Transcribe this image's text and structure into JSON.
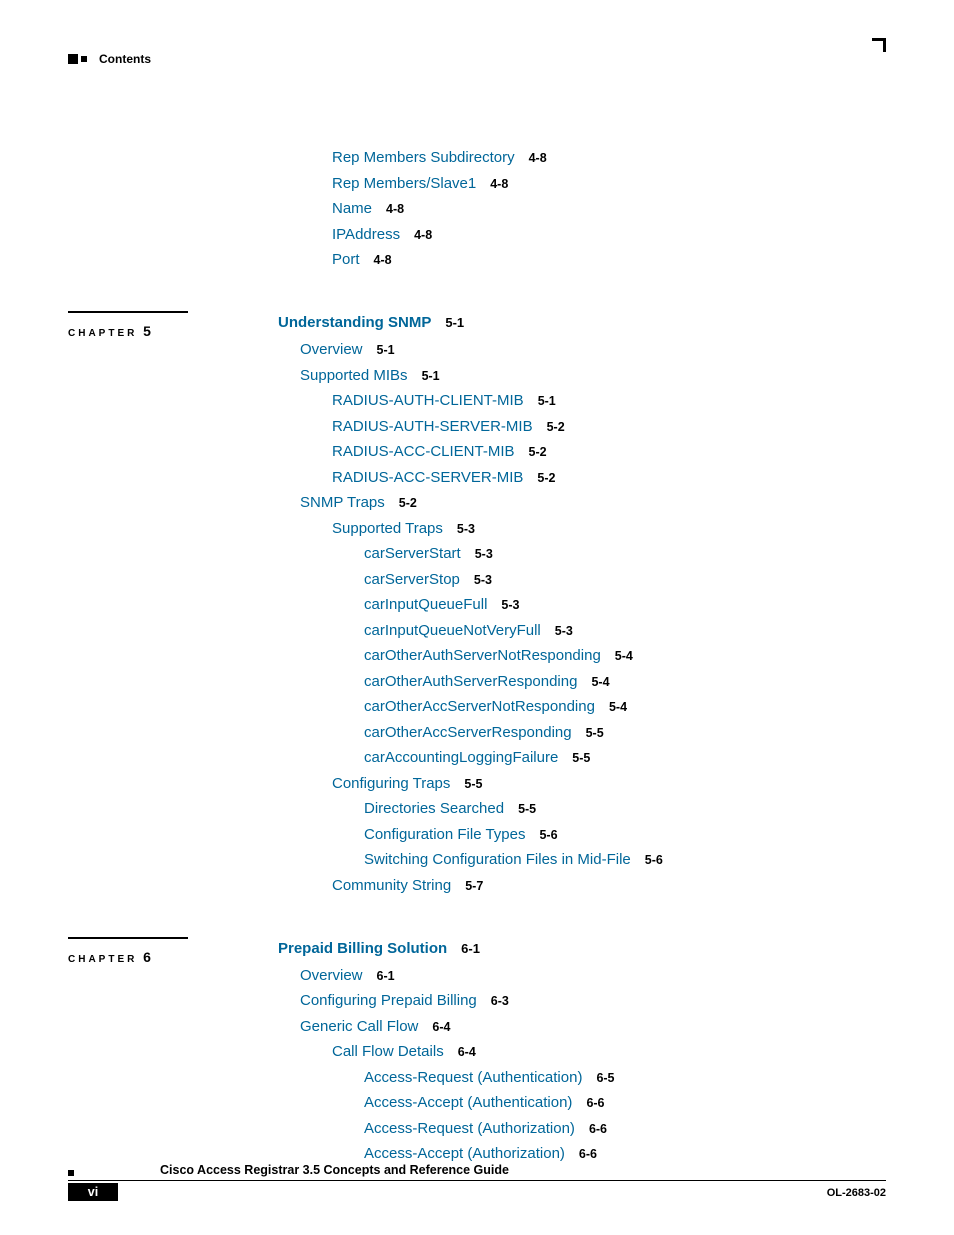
{
  "header": {
    "running_head": "Contents"
  },
  "footer": {
    "doc_title": "Cisco Access Registrar 3.5 Concepts and Reference Guide",
    "page_roman": "vi",
    "part_no": "OL-2683-02"
  },
  "groups": [
    {
      "chapter_label": "",
      "chapter_num": "",
      "items": [
        {
          "level": 2,
          "text": "Rep Members Subdirectory",
          "page": "4-8"
        },
        {
          "level": 2,
          "text": "Rep Members/Slave1",
          "page": "4-8"
        },
        {
          "level": 2,
          "text": "Name",
          "page": "4-8"
        },
        {
          "level": 2,
          "text": "IPAddress",
          "page": "4-8"
        },
        {
          "level": 2,
          "text": "Port",
          "page": "4-8"
        }
      ]
    },
    {
      "chapter_label": "CHAPTER",
      "chapter_num": "5",
      "chapter_title": "Understanding SNMP",
      "chapter_page": "5-1",
      "items": [
        {
          "level": 1,
          "text": "Overview",
          "page": "5-1",
          "gap": true
        },
        {
          "level": 1,
          "text": "Supported MIBs",
          "page": "5-1",
          "gap": true
        },
        {
          "level": 2,
          "text": "RADIUS-AUTH-CLIENT-MIB",
          "page": "5-1"
        },
        {
          "level": 2,
          "text": "RADIUS-AUTH-SERVER-MIB",
          "page": "5-2"
        },
        {
          "level": 2,
          "text": "RADIUS-ACC-CLIENT-MIB",
          "page": "5-2"
        },
        {
          "level": 2,
          "text": "RADIUS-ACC-SERVER-MIB",
          "page": "5-2"
        },
        {
          "level": 1,
          "text": "SNMP Traps",
          "page": "5-2",
          "gap": true
        },
        {
          "level": 2,
          "text": "Supported Traps",
          "page": "5-3"
        },
        {
          "level": 3,
          "text": "carServerStart",
          "page": "5-3"
        },
        {
          "level": 3,
          "text": "carServerStop",
          "page": "5-3"
        },
        {
          "level": 3,
          "text": "carInputQueueFull",
          "page": "5-3"
        },
        {
          "level": 3,
          "text": "carInputQueueNotVeryFull",
          "page": "5-3"
        },
        {
          "level": 3,
          "text": "carOtherAuthServerNotResponding",
          "page": "5-4"
        },
        {
          "level": 3,
          "text": "carOtherAuthServerResponding",
          "page": "5-4"
        },
        {
          "level": 3,
          "text": "carOtherAccServerNotResponding",
          "page": "5-4"
        },
        {
          "level": 3,
          "text": "carOtherAccServerResponding",
          "page": "5-5"
        },
        {
          "level": 3,
          "text": "carAccountingLoggingFailure",
          "page": "5-5"
        },
        {
          "level": 2,
          "text": "Configuring Traps",
          "page": "5-5"
        },
        {
          "level": 3,
          "text": "Directories Searched",
          "page": "5-5"
        },
        {
          "level": 3,
          "text": "Configuration File Types",
          "page": "5-6"
        },
        {
          "level": 3,
          "text": "Switching Configuration Files in Mid-File",
          "page": "5-6"
        },
        {
          "level": 2,
          "text": "Community String",
          "page": "5-7"
        }
      ]
    },
    {
      "chapter_label": "CHAPTER",
      "chapter_num": "6",
      "chapter_title": "Prepaid Billing Solution",
      "chapter_page": "6-1",
      "items": [
        {
          "level": 1,
          "text": "Overview",
          "page": "6-1",
          "gap": true
        },
        {
          "level": 1,
          "text": "Configuring Prepaid Billing",
          "page": "6-3",
          "gap": true
        },
        {
          "level": 1,
          "text": "Generic Call Flow",
          "page": "6-4",
          "gap": true
        },
        {
          "level": 2,
          "text": "Call Flow Details",
          "page": "6-4"
        },
        {
          "level": 3,
          "text": "Access-Request (Authentication)",
          "page": "6-5"
        },
        {
          "level": 3,
          "text": "Access-Accept (Authentication)",
          "page": "6-6"
        },
        {
          "level": 3,
          "text": "Access-Request (Authorization)",
          "page": "6-6"
        },
        {
          "level": 3,
          "text": "Access-Accept (Authorization)",
          "page": "6-6"
        }
      ]
    }
  ]
}
